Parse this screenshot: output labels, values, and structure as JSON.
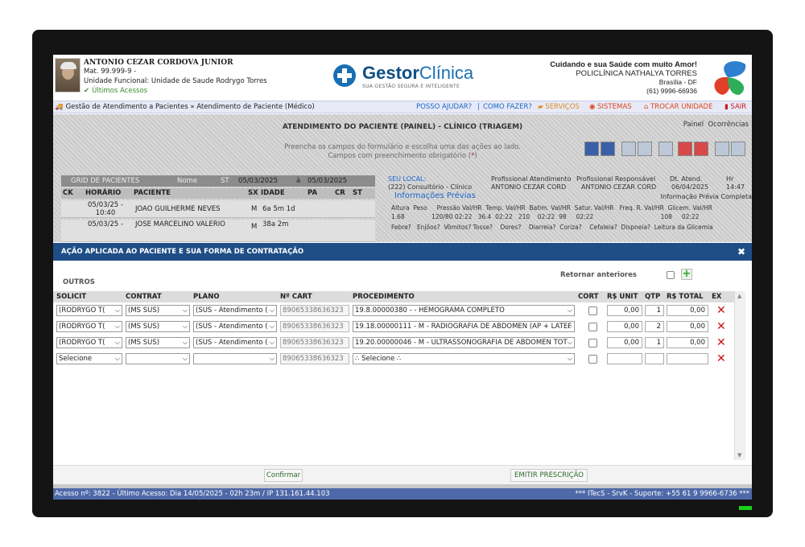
{
  "user": {
    "name": "ANTONIO CEZAR CORDOVA JUNIOR",
    "mat": "Mat. 99.999-9 -",
    "unit": "Unidade Funcional: Unidade de Saude Rodrygo Torres",
    "last_access": "Últimos Acessos"
  },
  "brand": {
    "name_bold": "Gestor",
    "name_light": "Clínica",
    "tagline": "SUA GESTÃO SEGURA E INTELIGENTE"
  },
  "clinic": {
    "slogan": "Cuidando e sua Saúde com muito Amor!",
    "name": "POLICLÍNICA NATHALYA TORRES",
    "city": "Brasília - DF",
    "phone": "(61) 9996-66936"
  },
  "nav": {
    "breadcrumb": "Gestão de Atendimento a Pacientes » Atendimento de Paciente (Médico)",
    "help": "POSSO AJUDAR?",
    "separator": "|",
    "how": "COMO FAZER?",
    "services": "SERVIÇOS",
    "systems": "SISTEMAS",
    "change_unit": "TROCAR UNIDADE",
    "exit": "SAIR"
  },
  "background": {
    "title": "ATENDIMENTO DO PACIENTE (PAINEL) - CLÍNICO (TRIAGEM)",
    "panel": "Painel",
    "occurrences": "Ocorrências",
    "hint1": "Preencha os campos do formulário e escolha uma das ações ao lado.",
    "hint2": "Campos com preenchimento obrigatório (",
    "hint2_req": "*",
    "hint2_end": ")",
    "grid_title": "GRID DE PACIENTES",
    "grid_name": "Nome",
    "grid_st": "ST",
    "date_from": "05/03/2025",
    "date_sep": "à",
    "date_to": "05/03/2025",
    "columns": [
      "CK",
      "HORÁRIO",
      "PACIENTE",
      "SX",
      "IDADE",
      "PA",
      "CR",
      "ST"
    ],
    "rows": [
      {
        "time": "05/03/25 - 10:40",
        "patient": "JOAO GUILHERME NEVES",
        "sex": "M",
        "age": "6a 5m 1d"
      },
      {
        "time": "05/03/25 -",
        "patient": "JOSE MARCELINO VALERIO",
        "sex": "M",
        "age": "38a 2m"
      }
    ],
    "local_label": "SEU LOCAL:",
    "local_value": "(222) Consultório - Clínico",
    "prof_att_label": "Profissional Atendimento",
    "prof_att_value": "ANTONIO CEZAR CORD",
    "prof_resp_label": "Profissional Responsável",
    "prof_resp_value": "ANTONIO CEZAR CORD",
    "dt_label": "Dt. Atend.",
    "dt_value": "06/04/2025",
    "hr_label": "Hr",
    "hr_value": "14:47",
    "info_title": "Informações Prévias",
    "info_complete": "Informação Prévia Completa",
    "vitals_labels": "Altura  Peso     Pressão Val/HR  Temp. Val/HR  Batim. Val/HR  Satur. Val/HR   Freq. R. Val/HR  Glicem. Val/HR",
    "vitals_values": "1.68              120/80 02:22   36.4  02:22   210    02:22  98     02:22                                   108     02:22",
    "symptoms": "Febre?   Enjôos?  Vômitos? Tosse?    Dores?    Diarreia?  Coriza?    Cefaleia?  Dispneia?  Leitura da Glicemia"
  },
  "modal": {
    "title": "AÇÃO APLICADA AO PACIENTE E SUA FORMA DE CONTRATAÇÃO",
    "close": "✖",
    "section": "OUTROS",
    "return_previous": "Retornar anteriores",
    "add": "+",
    "headers": {
      "solicit": "SOLICIT",
      "contrat": "CONTRAT",
      "plano": "PLANO",
      "cart": "Nº CART",
      "proc": "PROCEDIMENTO",
      "cort": "CORT",
      "unit": "R$ UNIT",
      "qtp": "QTP",
      "total": "R$ TOTAL",
      "ex": "EX"
    },
    "rows": [
      {
        "solicit": "(RODRYGO T(",
        "contrat": "(MS SUS)",
        "plano": "(SUS - Atendimento (",
        "cart": "89065338636323",
        "proc": "19.8.00000380 - - HEMOGRAMA COMPLETO",
        "unit": "0,00",
        "qtp": "1",
        "total": "0,00"
      },
      {
        "solicit": "(RODRYGO T(",
        "contrat": "(MS SUS)",
        "plano": "(SUS - Atendimento (",
        "cart": "89065338636323",
        "proc": "19.18.00000111 - M - RADIOGRAFIA DE ABDOMEN (AP + LATEF",
        "unit": "0,00",
        "qtp": "2",
        "total": "0,00"
      },
      {
        "solicit": "(RODRYGO T(",
        "contrat": "(MS SUS)",
        "plano": "(SUS - Atendimento (",
        "cart": "89065338636323",
        "proc": "19.20.00000046 - M - ULTRASSONOGRAFIA DE ABDOMEN TOT",
        "unit": "0,00",
        "qtp": "1",
        "total": "0,00"
      },
      {
        "solicit": "Selecione",
        "contrat": "",
        "plano": "",
        "cart": "89065338636323",
        "proc": "∴ Selecione ∴",
        "unit": "",
        "qtp": "",
        "total": ""
      }
    ],
    "confirm": "Confirmar",
    "prescription": "EMITIR PRESCRIÇÃO"
  },
  "status": {
    "left": "Acesso nº:  3822 - Último Acesso:  Dia 14/05/2025 - 02h 23m / IP  131.161.44.103",
    "right": "*** ITecS - SrvK - Suporte: +55 61 9 9966-6736 ***"
  },
  "colors": {
    "brand_blue": "#1a6fb3",
    "modal_header": "#1f4e86",
    "status_bar": "#4e69a8",
    "delete_red": "#d01010"
  }
}
